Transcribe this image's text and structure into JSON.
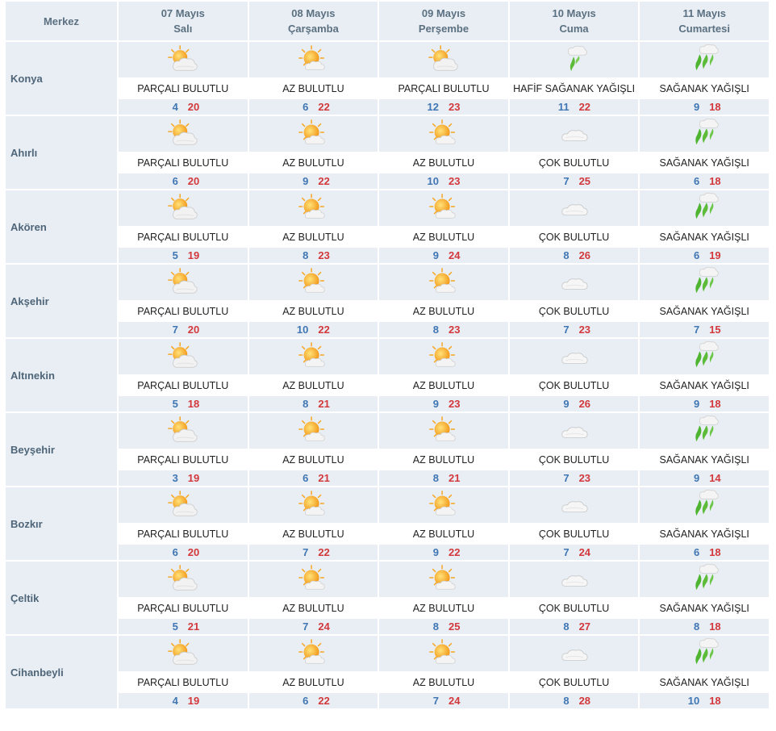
{
  "header": {
    "first_col": "Merkez",
    "days": [
      {
        "date": "07 Mayıs",
        "weekday": "Salı"
      },
      {
        "date": "08 Mayıs",
        "weekday": "Çarşamba"
      },
      {
        "date": "09 Mayıs",
        "weekday": "Perşembe"
      },
      {
        "date": "10 Mayıs",
        "weekday": "Cuma"
      },
      {
        "date": "11 Mayıs",
        "weekday": "Cumartesi"
      }
    ]
  },
  "colors": {
    "header_bg": "#e8eef3",
    "min_temp": "#3f76b3",
    "max_temp": "#d2383c",
    "name_text": "#4f6579"
  },
  "rows": [
    {
      "name": "Konya",
      "days": [
        {
          "icon": "partly-cloudy-icon",
          "cond": "PARÇALI BULUTLU",
          "min": "4",
          "max": "20"
        },
        {
          "icon": "mostly-sunny-icon",
          "cond": "AZ BULUTLU",
          "min": "6",
          "max": "22"
        },
        {
          "icon": "partly-cloudy-icon",
          "cond": "PARÇALI BULUTLU",
          "min": "12",
          "max": "23"
        },
        {
          "icon": "light-shower-icon",
          "cond": "HAFİF SAĞANAK YAĞIŞLI",
          "min": "11",
          "max": "22"
        },
        {
          "icon": "shower-icon",
          "cond": "SAĞANAK YAĞIŞLI",
          "min": "9",
          "max": "18"
        }
      ]
    },
    {
      "name": "Ahırlı",
      "days": [
        {
          "icon": "partly-cloudy-icon",
          "cond": "PARÇALI BULUTLU",
          "min": "6",
          "max": "20"
        },
        {
          "icon": "mostly-sunny-icon",
          "cond": "AZ BULUTLU",
          "min": "9",
          "max": "22"
        },
        {
          "icon": "mostly-sunny-icon",
          "cond": "AZ BULUTLU",
          "min": "10",
          "max": "23"
        },
        {
          "icon": "cloudy-icon",
          "cond": "ÇOK BULUTLU",
          "min": "7",
          "max": "25"
        },
        {
          "icon": "shower-icon",
          "cond": "SAĞANAK YAĞIŞLI",
          "min": "6",
          "max": "18"
        }
      ]
    },
    {
      "name": "Akören",
      "days": [
        {
          "icon": "partly-cloudy-icon",
          "cond": "PARÇALI BULUTLU",
          "min": "5",
          "max": "19"
        },
        {
          "icon": "mostly-sunny-icon",
          "cond": "AZ BULUTLU",
          "min": "8",
          "max": "23"
        },
        {
          "icon": "mostly-sunny-icon",
          "cond": "AZ BULUTLU",
          "min": "9",
          "max": "24"
        },
        {
          "icon": "cloudy-icon",
          "cond": "ÇOK BULUTLU",
          "min": "8",
          "max": "26"
        },
        {
          "icon": "shower-icon",
          "cond": "SAĞANAK YAĞIŞLI",
          "min": "6",
          "max": "19"
        }
      ]
    },
    {
      "name": "Akşehir",
      "days": [
        {
          "icon": "partly-cloudy-icon",
          "cond": "PARÇALI BULUTLU",
          "min": "7",
          "max": "20"
        },
        {
          "icon": "mostly-sunny-icon",
          "cond": "AZ BULUTLU",
          "min": "10",
          "max": "22"
        },
        {
          "icon": "mostly-sunny-icon",
          "cond": "AZ BULUTLU",
          "min": "8",
          "max": "23"
        },
        {
          "icon": "cloudy-icon",
          "cond": "ÇOK BULUTLU",
          "min": "7",
          "max": "23"
        },
        {
          "icon": "shower-icon",
          "cond": "SAĞANAK YAĞIŞLI",
          "min": "7",
          "max": "15"
        }
      ]
    },
    {
      "name": "Altınekin",
      "days": [
        {
          "icon": "partly-cloudy-icon",
          "cond": "PARÇALI BULUTLU",
          "min": "5",
          "max": "18"
        },
        {
          "icon": "mostly-sunny-icon",
          "cond": "AZ BULUTLU",
          "min": "8",
          "max": "21"
        },
        {
          "icon": "mostly-sunny-icon",
          "cond": "AZ BULUTLU",
          "min": "9",
          "max": "23"
        },
        {
          "icon": "cloudy-icon",
          "cond": "ÇOK BULUTLU",
          "min": "9",
          "max": "26"
        },
        {
          "icon": "shower-icon",
          "cond": "SAĞANAK YAĞIŞLI",
          "min": "9",
          "max": "18"
        }
      ]
    },
    {
      "name": "Beyşehir",
      "days": [
        {
          "icon": "partly-cloudy-icon",
          "cond": "PARÇALI BULUTLU",
          "min": "3",
          "max": "19"
        },
        {
          "icon": "mostly-sunny-icon",
          "cond": "AZ BULUTLU",
          "min": "6",
          "max": "21"
        },
        {
          "icon": "mostly-sunny-icon",
          "cond": "AZ BULUTLU",
          "min": "8",
          "max": "21"
        },
        {
          "icon": "cloudy-icon",
          "cond": "ÇOK BULUTLU",
          "min": "7",
          "max": "23"
        },
        {
          "icon": "shower-icon",
          "cond": "SAĞANAK YAĞIŞLI",
          "min": "9",
          "max": "14"
        }
      ]
    },
    {
      "name": "Bozkır",
      "days": [
        {
          "icon": "partly-cloudy-icon",
          "cond": "PARÇALI BULUTLU",
          "min": "6",
          "max": "20"
        },
        {
          "icon": "mostly-sunny-icon",
          "cond": "AZ BULUTLU",
          "min": "7",
          "max": "22"
        },
        {
          "icon": "mostly-sunny-icon",
          "cond": "AZ BULUTLU",
          "min": "9",
          "max": "22"
        },
        {
          "icon": "cloudy-icon",
          "cond": "ÇOK BULUTLU",
          "min": "7",
          "max": "24"
        },
        {
          "icon": "shower-icon",
          "cond": "SAĞANAK YAĞIŞLI",
          "min": "6",
          "max": "18"
        }
      ]
    },
    {
      "name": "Çeltik",
      "days": [
        {
          "icon": "partly-cloudy-icon",
          "cond": "PARÇALI BULUTLU",
          "min": "5",
          "max": "21"
        },
        {
          "icon": "mostly-sunny-icon",
          "cond": "AZ BULUTLU",
          "min": "7",
          "max": "24"
        },
        {
          "icon": "mostly-sunny-icon",
          "cond": "AZ BULUTLU",
          "min": "8",
          "max": "25"
        },
        {
          "icon": "cloudy-icon",
          "cond": "ÇOK BULUTLU",
          "min": "8",
          "max": "27"
        },
        {
          "icon": "shower-icon",
          "cond": "SAĞANAK YAĞIŞLI",
          "min": "8",
          "max": "18"
        }
      ]
    },
    {
      "name": "Cihanbeyli",
      "days": [
        {
          "icon": "partly-cloudy-icon",
          "cond": "PARÇALI BULUTLU",
          "min": "4",
          "max": "19"
        },
        {
          "icon": "mostly-sunny-icon",
          "cond": "AZ BULUTLU",
          "min": "6",
          "max": "22"
        },
        {
          "icon": "mostly-sunny-icon",
          "cond": "AZ BULUTLU",
          "min": "7",
          "max": "24"
        },
        {
          "icon": "cloudy-icon",
          "cond": "ÇOK BULUTLU",
          "min": "8",
          "max": "28"
        },
        {
          "icon": "shower-icon",
          "cond": "SAĞANAK YAĞIŞLI",
          "min": "10",
          "max": "18"
        }
      ]
    }
  ]
}
